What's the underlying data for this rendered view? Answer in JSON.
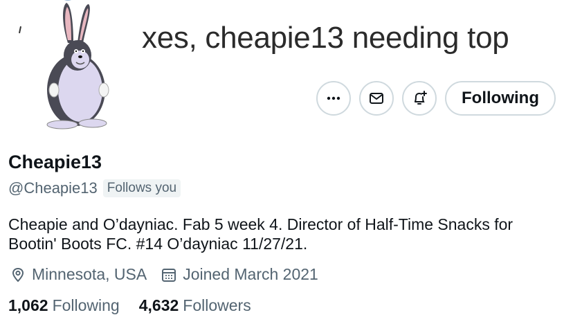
{
  "banner": {
    "text": "xes, cheapie13 needing top"
  },
  "actions": {
    "following_label": "Following"
  },
  "profile": {
    "display_name": "Cheapie13",
    "handle": "@Cheapie13",
    "follows_you": "Follows you",
    "bio": "Cheapie and O’dayniac. Fab 5 week 4. Director of Half-Time Snacks for Bootin' Boots FC. #14 O’dayniac 11/27/21.",
    "location": "Minnesota, USA",
    "joined": "Joined March 2021"
  },
  "stats": {
    "following_count": "1,062",
    "following_label": "Following",
    "followers_count": "4,632",
    "followers_label": "Followers"
  },
  "icons": {
    "more": "more-icon",
    "message": "envelope-icon",
    "notify": "bell-plus-icon",
    "location": "location-pin-icon",
    "calendar": "calendar-icon"
  },
  "colors": {
    "text": "#0f1419",
    "secondary": "#536471",
    "border": "#cfd9de",
    "badge_bg": "#eff3f4"
  }
}
